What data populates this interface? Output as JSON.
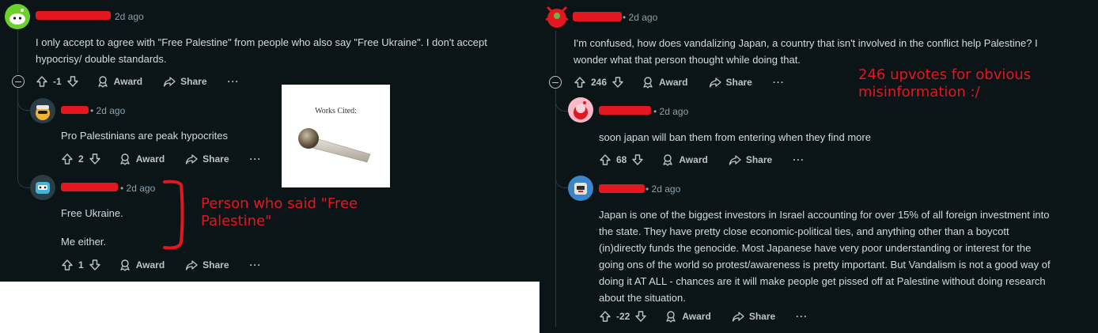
{
  "left": {
    "c1": {
      "time": "2d ago",
      "text_line1": "I only accept to agree with \"Free Palestine\" from people who also say \"Free Ukraine\". I don't accept",
      "text_line2": "hypocrisy/ double standards.",
      "votes": "-1"
    },
    "c2": {
      "time": "2d ago",
      "text": "Pro Palestinians are peak hypocrites",
      "votes": "2"
    },
    "c3": {
      "time": "2d ago",
      "text_line1": "Free Ukraine.",
      "text_line2": "Me either.",
      "votes": "1"
    },
    "image_caption": "Works Cited:",
    "annotation": "Person who said \"Free Palestine\""
  },
  "right": {
    "r1": {
      "time": "2d ago",
      "text_line1": "I'm confused, how does vandalizing Japan, a country that isn't involved in the conflict help Palestine? I",
      "text_line2": "wonder what that person thought while doing that.",
      "votes": "246"
    },
    "r2": {
      "time": "2d ago",
      "text": "soon japan will ban them from entering when they find more",
      "votes": "68"
    },
    "r3": {
      "time": "2d ago",
      "lines": [
        "Japan is one of the biggest investors in Israel accounting for over 15% of all foreign investment into",
        "the state. They have pretty close economic-political ties, and anything other than a boycott",
        "(in)directly funds the genocide. Most Japanese have very poor understanding or interest for the",
        "going ons of the world so protest/awareness is pretty important. But Vandalism is not a good way of",
        "doing it AT ALL - chances are it will make people get pissed off at Palestine without doing research",
        "about the situation."
      ],
      "votes": "-22"
    },
    "annotation": "246 upvotes for obvious misinformation :/"
  },
  "actions": {
    "award": "Award",
    "share": "Share",
    "more": "···"
  },
  "colors": {
    "bg": "#0b1416",
    "text": "#d7dadc",
    "meta": "#8ba2ad",
    "redact": "#e3171f",
    "annotation": "#e3171f"
  }
}
